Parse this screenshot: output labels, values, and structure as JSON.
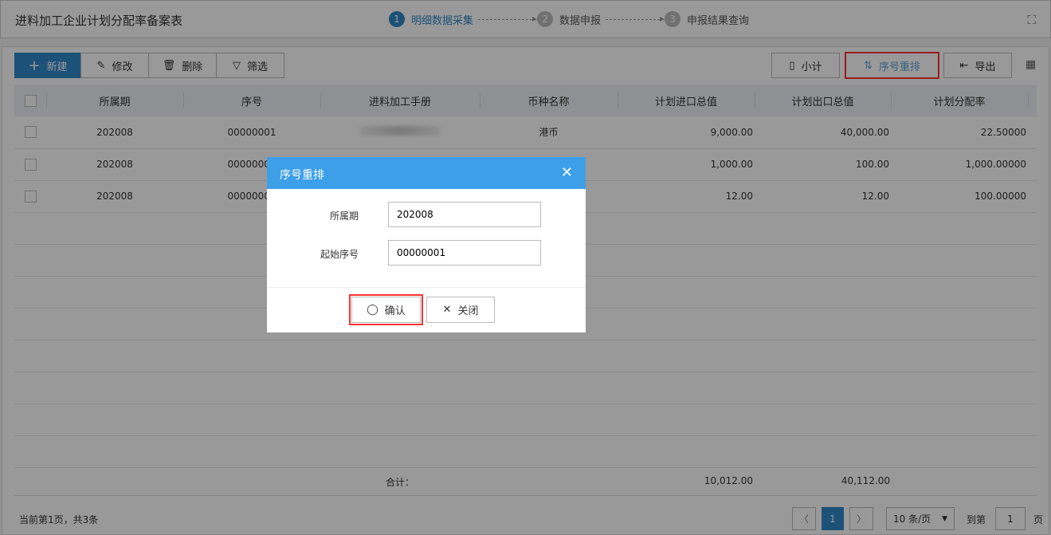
{
  "header": {
    "title": "进料加工企业计划分配率备案表",
    "steps": [
      {
        "num": "1",
        "label": "明细数据采集"
      },
      {
        "num": "2",
        "label": "数据申报"
      },
      {
        "num": "3",
        "label": "申报结果查询"
      }
    ]
  },
  "toolbar": {
    "new": "新建",
    "edit": "修改",
    "delete": "删除",
    "filter": "筛选",
    "subtotal": "小计",
    "renumber": "序号重排",
    "export": "导出"
  },
  "table": {
    "columns": [
      "所属期",
      "序号",
      "进料加工手册",
      "币种名称",
      "计划进口总值",
      "计划出口总值",
      "计划分配率"
    ],
    "rows": [
      [
        "202008",
        "00000001",
        "",
        "港币",
        "9,000.00",
        "40,000.00",
        "22.50000"
      ],
      [
        "202008",
        "00000002",
        "",
        "",
        "1,000.00",
        "100.00",
        "1,000.00000"
      ],
      [
        "202008",
        "00000003",
        "",
        "",
        "12.00",
        "12.00",
        "100.00000"
      ]
    ],
    "total_label": "合计：",
    "total_import": "10,012.00",
    "total_export": "40,112.00"
  },
  "footer": {
    "status": "当前第1页，共3条",
    "page": "1",
    "page_size": "10 条/页",
    "goto_label": "到第",
    "goto_value": "1",
    "page_unit": "页"
  },
  "dialog": {
    "title": "序号重排",
    "period_label": "所属期",
    "period_value": "202008",
    "start_label": "起始序号",
    "start_value": "00000001",
    "confirm": "确认",
    "close": "关闭"
  },
  "colors": {
    "accent": "#2f88c9",
    "dialog_header": "#3c9fe8",
    "highlight": "#ff3333"
  }
}
